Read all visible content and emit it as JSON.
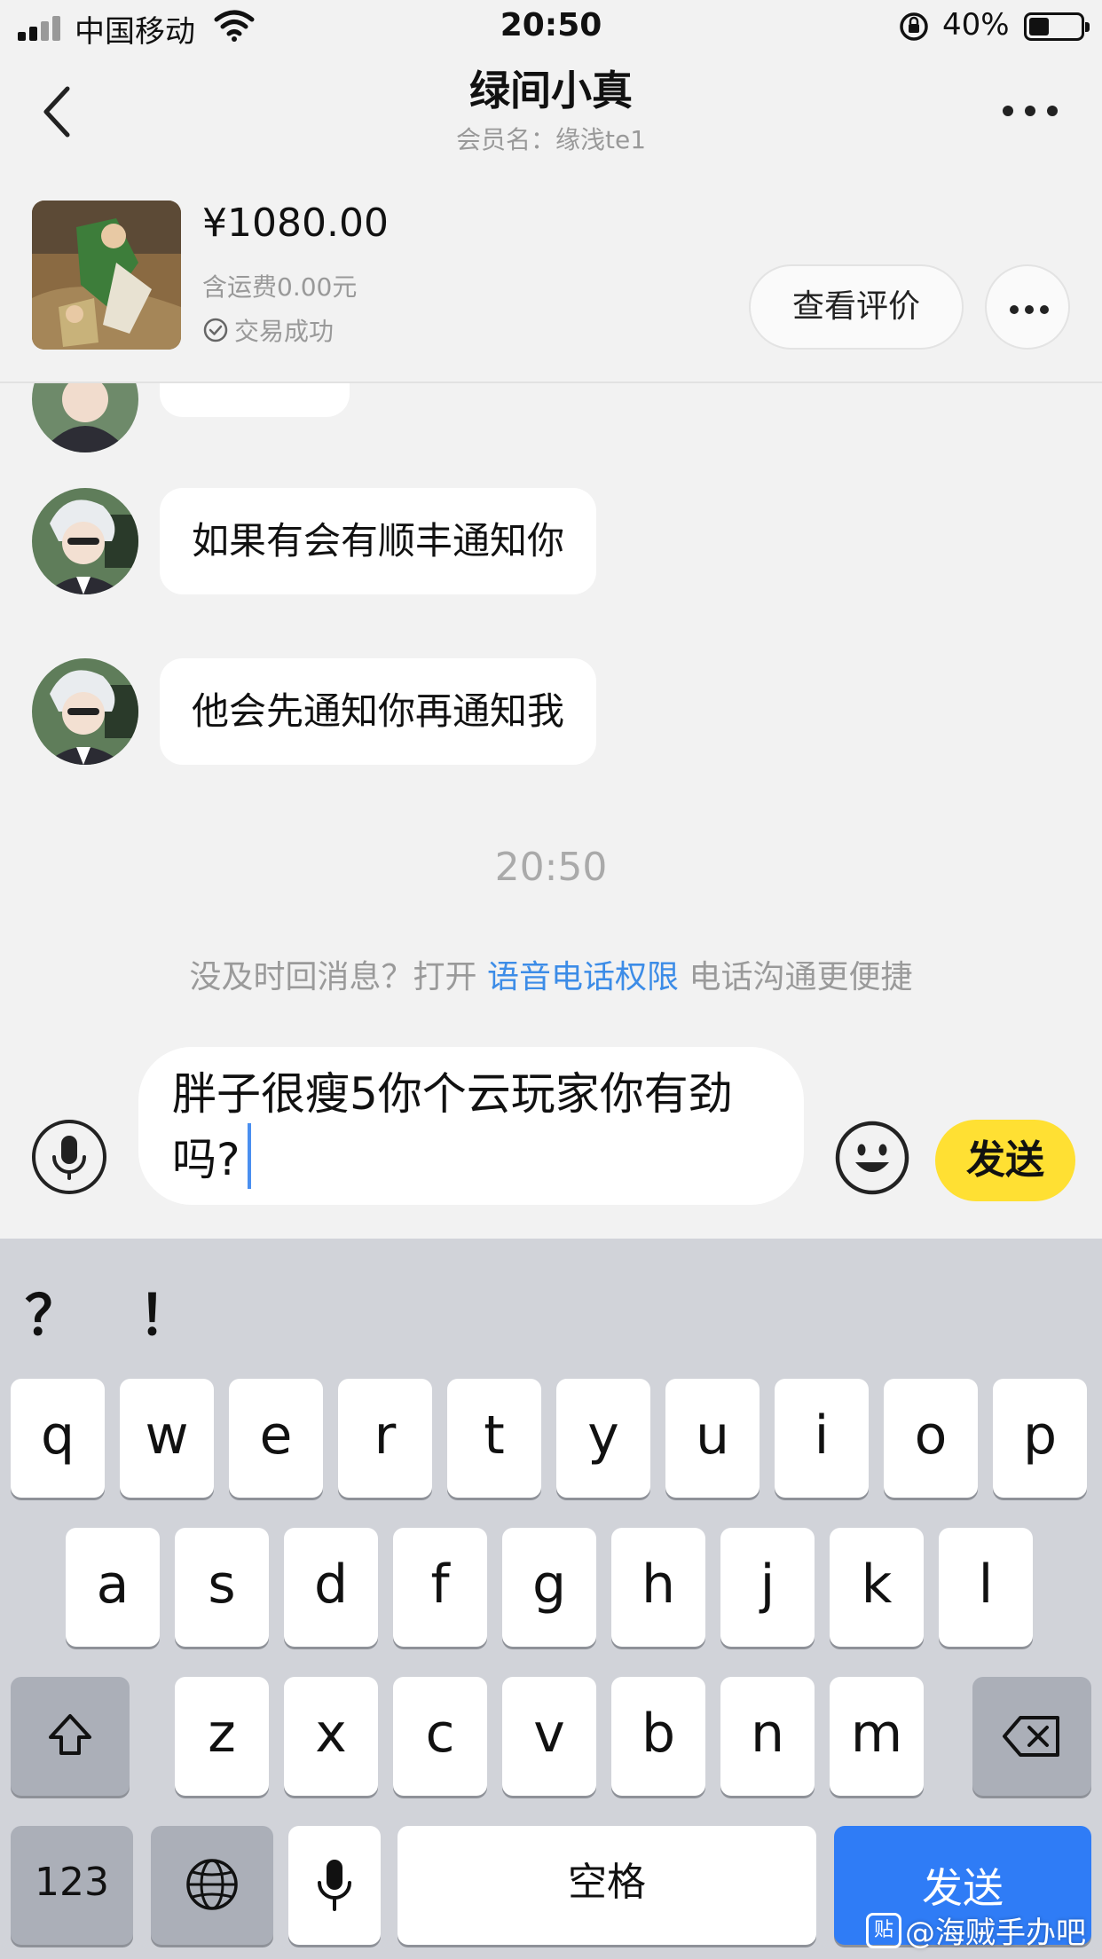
{
  "status_bar": {
    "carrier": "中国移动",
    "time": "20:50",
    "battery": "40%",
    "battery_level": 0.4
  },
  "nav": {
    "title": "绿间小真",
    "member_label": "会员名：缘浅te1"
  },
  "product": {
    "price": "¥1080.00",
    "shipping": "含运费0.00元",
    "status": "交易成功",
    "review_button": "查看评价"
  },
  "chat": {
    "messages": [
      {
        "text": "如果有会有顺丰通知你"
      },
      {
        "text": "他会先通知你再通知我"
      }
    ],
    "timestamp": "20:50",
    "notice_before": "没及时回消息？打开",
    "notice_link": "语音电话权限",
    "notice_after": "电话沟通更便捷"
  },
  "input": {
    "text": "胖子很瘦5你个云玩家你有劲吗?",
    "send_label": "发送"
  },
  "keyboard": {
    "suggestions": [
      "？",
      "！"
    ],
    "row1": [
      "q",
      "w",
      "e",
      "r",
      "t",
      "y",
      "u",
      "i",
      "o",
      "p"
    ],
    "row2": [
      "a",
      "s",
      "d",
      "f",
      "g",
      "h",
      "j",
      "k",
      "l"
    ],
    "row3": [
      "z",
      "x",
      "c",
      "v",
      "b",
      "n",
      "m"
    ],
    "numbers_key": "123",
    "space_key": "空格",
    "send_key": "发送"
  },
  "watermark": {
    "icon_text": "贴",
    "text": "@海贼手办吧"
  },
  "colors": {
    "send_button": "#ffe033",
    "link": "#3c8ce7",
    "keyboard_send": "#2f7cf6"
  },
  "icons": [
    "back-icon",
    "more-icon",
    "check-icon",
    "mic-icon",
    "emoji-icon",
    "shift-icon",
    "delete-icon",
    "globe-icon"
  ]
}
